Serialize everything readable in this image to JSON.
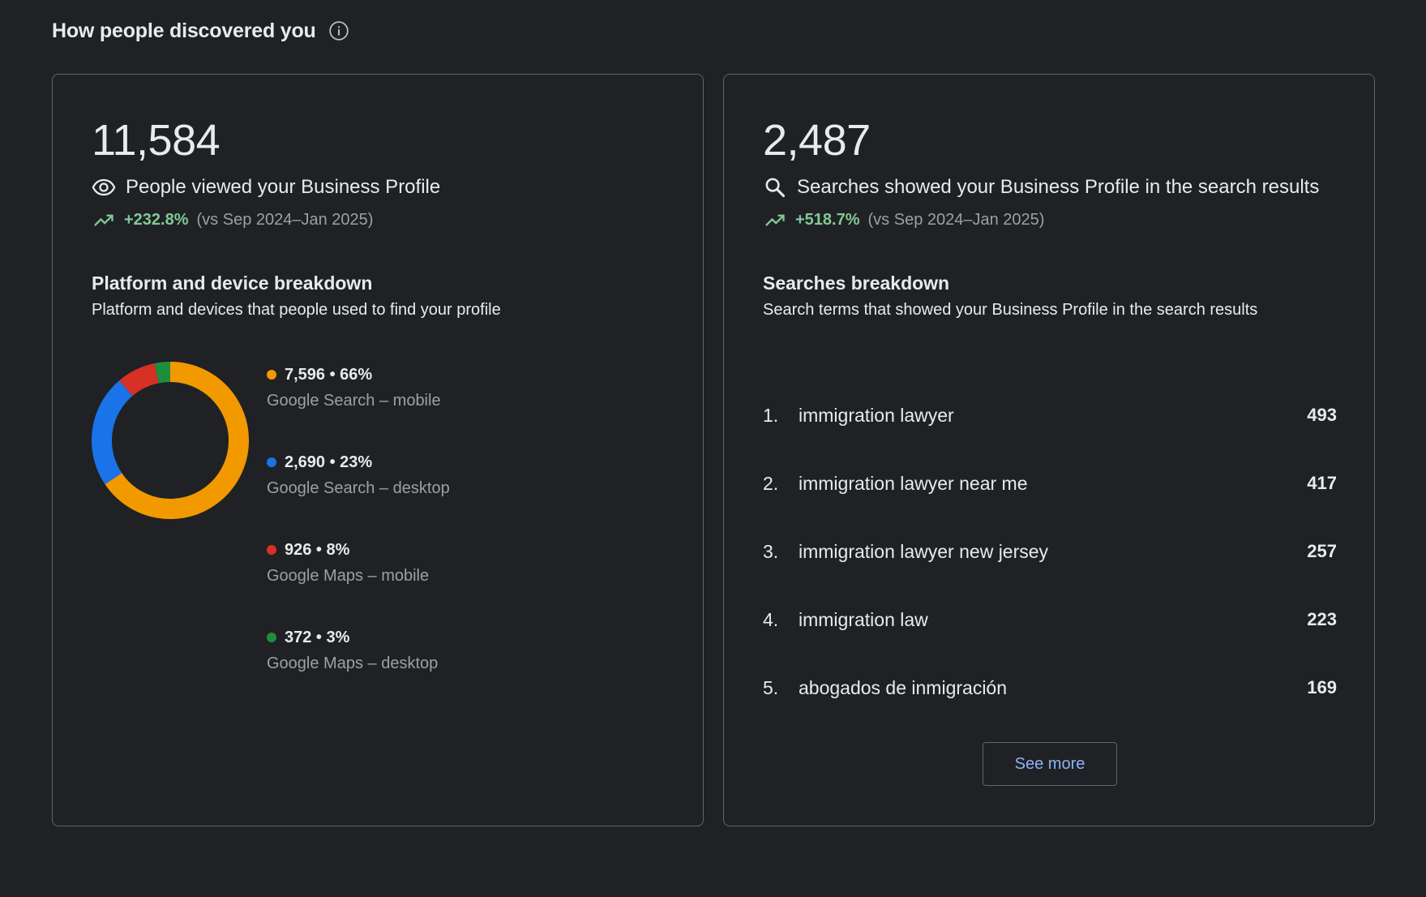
{
  "header": {
    "title": "How people discovered you",
    "info_icon": "info-icon"
  },
  "views_card": {
    "total": "11,584",
    "label": "People viewed your Business Profile",
    "label_icon": "eye-icon",
    "trend_icon": "trending-up-icon",
    "trend_value": "+232.8%",
    "trend_compare": "(vs Sep 2024–Jan 2025)",
    "breakdown_title": "Platform and device breakdown",
    "breakdown_desc": "Platform and devices that people used to find your profile",
    "colors": {
      "trend": "#81c995"
    },
    "chart_data": {
      "type": "pie",
      "categories": [
        "Google Search – mobile",
        "Google Search – desktop",
        "Google Maps – mobile",
        "Google Maps – desktop"
      ],
      "values": [
        7596,
        2690,
        926,
        372
      ],
      "percents": [
        66,
        23,
        8,
        3
      ],
      "colors": [
        "#f29900",
        "#1a73e8",
        "#d93025",
        "#1e8e3e"
      ],
      "legend": "right"
    },
    "legend": [
      {
        "value": "7,596 • 66%",
        "label": "Google Search – mobile",
        "color": "#f29900"
      },
      {
        "value": "2,690 • 23%",
        "label": "Google Search – desktop",
        "color": "#1a73e8"
      },
      {
        "value": "926 • 8%",
        "label": "Google Maps – mobile",
        "color": "#d93025"
      },
      {
        "value": "372 • 3%",
        "label": "Google Maps – desktop",
        "color": "#1e8e3e"
      }
    ]
  },
  "searches_card": {
    "total": "2,487",
    "label": "Searches showed your Business Profile in the search results",
    "label_icon": "search-icon",
    "trend_icon": "trending-up-icon",
    "trend_value": "+518.7%",
    "trend_compare": "(vs Sep 2024–Jan 2025)",
    "breakdown_title": "Searches breakdown",
    "breakdown_desc": "Search terms that showed your Business Profile in the search results",
    "terms": [
      {
        "rank": "1.",
        "term": "immigration lawyer",
        "count": "493"
      },
      {
        "rank": "2.",
        "term": "immigration lawyer near me",
        "count": "417"
      },
      {
        "rank": "3.",
        "term": "immigration lawyer new jersey",
        "count": "257"
      },
      {
        "rank": "4.",
        "term": "immigration law",
        "count": "223"
      },
      {
        "rank": "5.",
        "term": "abogados de inmigración",
        "count": "169"
      }
    ],
    "see_more_label": "See more"
  }
}
